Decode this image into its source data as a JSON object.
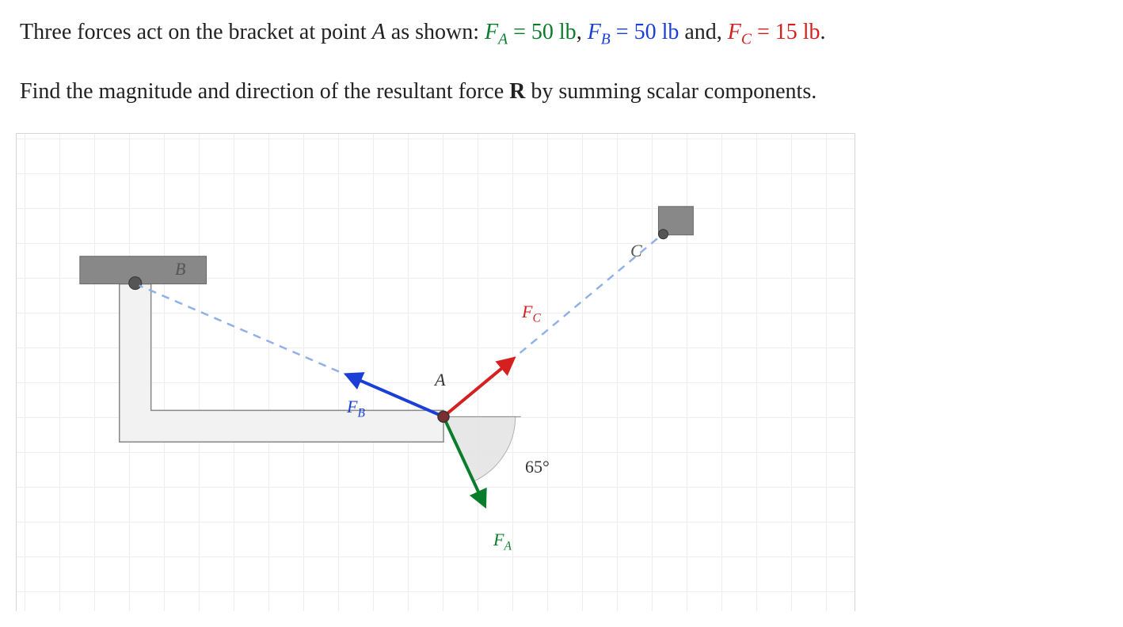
{
  "problem": {
    "prefix": "Three forces act on the bracket at point ",
    "pointA": "A",
    "as_shown": " as shown:  ",
    "FA_sym": "F",
    "FA_sub": "A",
    "eq": " = ",
    "FA_val": "50 lb",
    "comma1": ", ",
    "FB_sym": "F",
    "FB_sub": "B",
    "FB_val": "50 lb",
    "and": " and, ",
    "FC_sym": "F",
    "FC_sub": "C",
    "FC_val": "15 lb",
    "period": ".",
    "line2a": "Find the magnitude and direction of the resultant force ",
    "R": "R",
    "line2b": " by summing scalar components."
  },
  "labels": {
    "A": "A",
    "B": "B",
    "C": "C",
    "FA": "F",
    "FA_sub": "A",
    "FB": "F",
    "FB_sub": "B",
    "FC": "F",
    "FC_sub": "C",
    "angle": "65°"
  },
  "chart_data": {
    "type": "force-diagram",
    "title": "Bracket with three forces at point A",
    "point": "A",
    "angle_FA_from_negative_x": 65,
    "forces": [
      {
        "name": "F_A",
        "magnitude_lb": 50,
        "color": "#0a7d2c",
        "direction": "65° below +x axis (into fourth quadrant)"
      },
      {
        "name": "F_B",
        "magnitude_lb": 50,
        "color": "#1a3fd6",
        "direction": "along AB toward upper-left (toward B)"
      },
      {
        "name": "F_C",
        "magnitude_lb": 15,
        "color": "#d62020",
        "direction": "along AC toward upper-right (toward C)"
      }
    ],
    "geometry_grid_units": {
      "A": [
        12,
        8
      ],
      "B": [
        3,
        4
      ],
      "C": [
        18.5,
        3
      ],
      "note": "grid squares from top-left of diagram; approximate readings from figure"
    }
  }
}
